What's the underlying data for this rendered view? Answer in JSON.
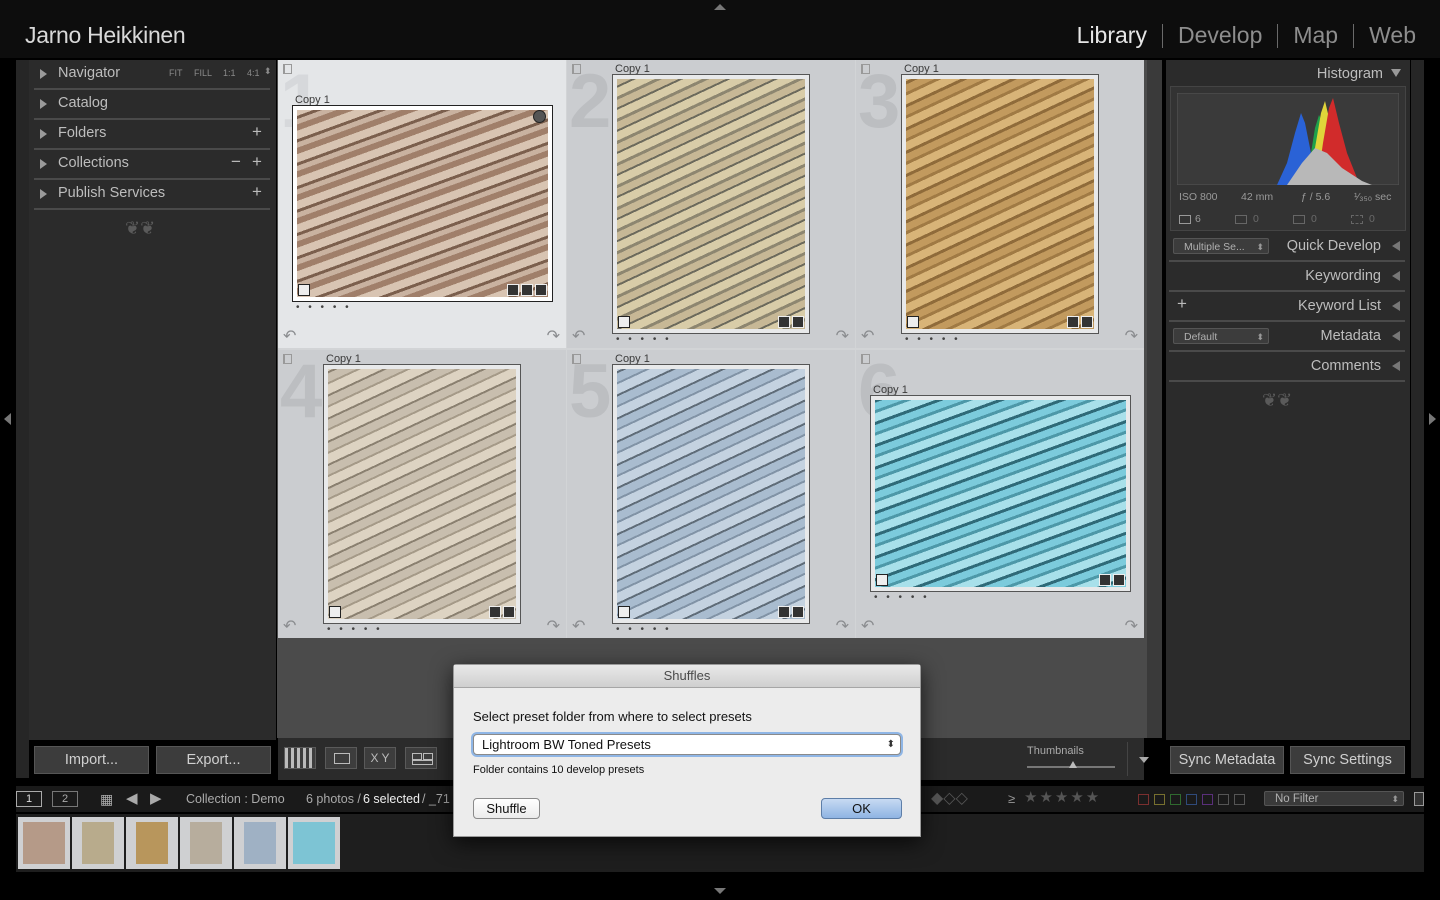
{
  "identity_plate": "Jarno Heikkinen",
  "modules": [
    {
      "label": "Library",
      "active": true
    },
    {
      "label": "Develop",
      "active": false
    },
    {
      "label": "Map",
      "active": false
    },
    {
      "label": "Web",
      "active": false
    }
  ],
  "left_panel": {
    "navigator": {
      "label": "Navigator",
      "zoom_options": [
        "FIT",
        "FILL",
        "1:1",
        "4:1"
      ]
    },
    "sections": [
      "Catalog",
      "Folders",
      "Collections",
      "Publish Services"
    ]
  },
  "right_panel": {
    "histogram": {
      "label": "Histogram",
      "iso": "ISO 800",
      "focal": "42 mm",
      "aperture": "ƒ / 5.6",
      "shutter": "¹⁄₃₅₀ sec",
      "counts": [
        "6",
        "0",
        "0",
        "0"
      ]
    },
    "quick_develop": {
      "label": "Quick Develop",
      "select": "Multiple Se..."
    },
    "keywording": "Keywording",
    "keyword_list": "Keyword List",
    "metadata": {
      "label": "Metadata",
      "select": "Default"
    },
    "comments": "Comments"
  },
  "grid": {
    "cells": [
      {
        "num": "1",
        "label": "Copy 1",
        "color": "#b59a88"
      },
      {
        "num": "2",
        "label": "Copy 1",
        "color": "#b8ab8c"
      },
      {
        "num": "3",
        "label": "Copy 1",
        "color": "#b8965c"
      },
      {
        "num": "4",
        "label": "Copy 1",
        "color": "#b7ad9d"
      },
      {
        "num": "5",
        "label": "Copy 1",
        "color": "#9fb1c4"
      },
      {
        "num": "6",
        "label": "Copy 1",
        "color": "#7dc4d4"
      }
    ],
    "dots": "• • • • •"
  },
  "buttons": {
    "import": "Import...",
    "export": "Export...",
    "sync_metadata": "Sync Metadata",
    "sync_settings": "Sync Settings"
  },
  "toolbar": {
    "thumbnails_label": "Thumbnails",
    "xy_label": "X Y"
  },
  "filmstrip": {
    "screen1": "1",
    "screen2": "2",
    "collection": "Collection : Demo",
    "count": "6 photos /",
    "selected": "6 selected",
    "file_tail": "/ _71",
    "filter_label": "≥",
    "no_filter": "No Filter"
  },
  "dialog": {
    "title": "Shuffles",
    "prompt": "Select preset folder from where to select presets",
    "folder": "Lightroom BW Toned Presets",
    "info": "Folder contains 10 develop presets",
    "shuffle": "Shuffle",
    "ok": "OK"
  }
}
